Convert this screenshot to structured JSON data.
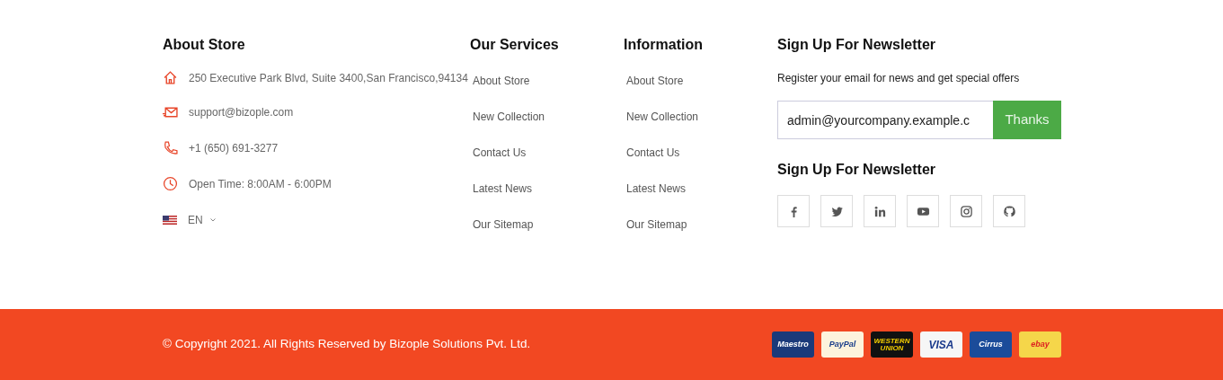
{
  "about": {
    "title": "About Store",
    "items": [
      {
        "kind": "address",
        "text": "250 Executive Park Blvd, Suite 3400,San Francisco,94134"
      },
      {
        "kind": "email",
        "text": "support@bizople.com"
      },
      {
        "kind": "phone",
        "text": "+1 (650) 691-3277"
      },
      {
        "kind": "time",
        "text": "Open Time: 8:00AM - 6:00PM"
      }
    ],
    "language": "EN"
  },
  "services": {
    "title": "Our Services",
    "links": [
      "About Store",
      "New Collection",
      "Contact Us",
      "Latest News",
      "Our Sitemap"
    ]
  },
  "information": {
    "title": "Information",
    "links": [
      "About Store",
      "New Collection",
      "Contact Us",
      "Latest News",
      "Our Sitemap"
    ]
  },
  "newsletter": {
    "title": "Sign Up For Newsletter",
    "text": "Register your email for news and get special offers",
    "email": "admin@yourcompany.example.c",
    "button": "Thanks",
    "social_title": "Sign Up For Newsletter",
    "social": [
      {
        "kind": "facebook"
      },
      {
        "kind": "twitter"
      },
      {
        "kind": "linkedin"
      },
      {
        "kind": "youtube"
      },
      {
        "kind": "instagram"
      },
      {
        "kind": "github"
      }
    ]
  },
  "bottom_bar": {
    "copyright": "© Copyright 2021. All Rights Reserved by Bizople Solutions Pvt. Ltd.",
    "payments": [
      {
        "kind": "maestro",
        "label": "Maestro"
      },
      {
        "kind": "paypal",
        "label": "PayPal"
      },
      {
        "kind": "western_union",
        "label": "WESTERN UNION"
      },
      {
        "kind": "visa",
        "label": "VISA"
      },
      {
        "kind": "cirrus",
        "label": "Cirrus"
      },
      {
        "kind": "ebay",
        "label": "ebay"
      }
    ]
  }
}
